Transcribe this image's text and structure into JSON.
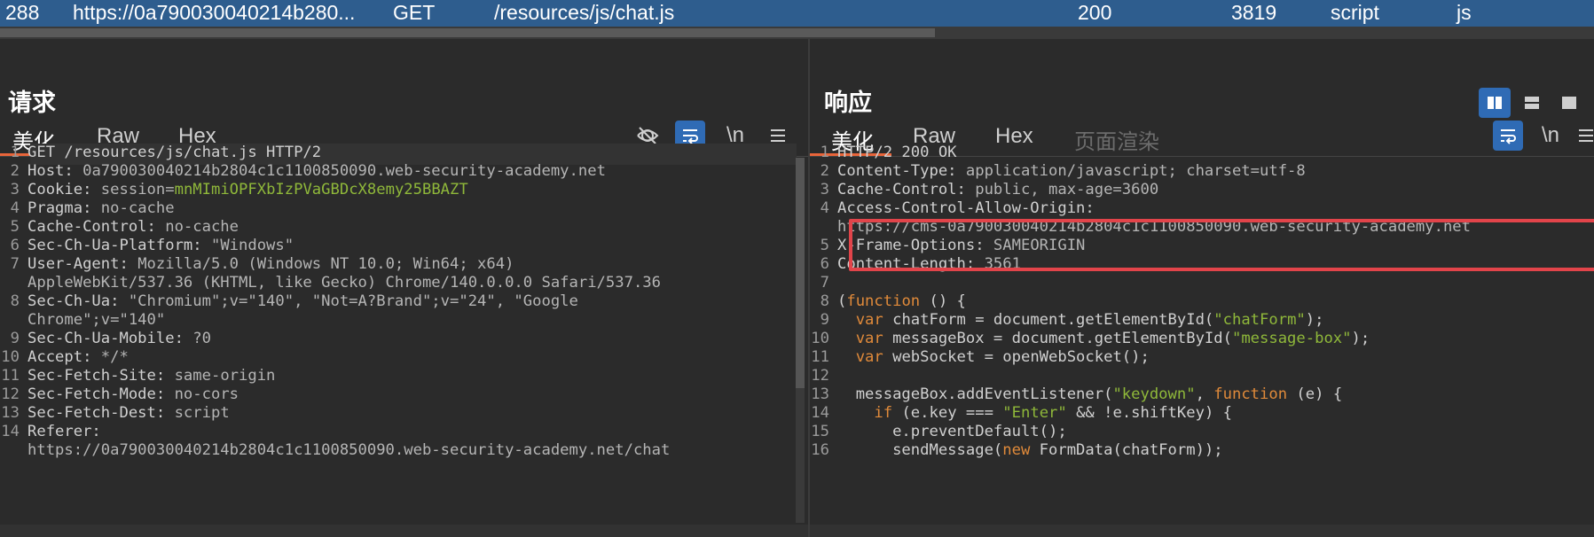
{
  "top_row": {
    "num": "288",
    "host": "https://0a790030040214b280...",
    "method": "GET",
    "path": "/resources/js/chat.js",
    "status": "200",
    "length": "3819",
    "type": "script",
    "ext": "js",
    "bg_color": "#2e5d8e"
  },
  "request": {
    "title": "请求",
    "tabs": [
      "美化",
      "Raw",
      "Hex"
    ],
    "active_tab": "美化",
    "toolbar_icons": [
      "eye-off-icon",
      "wrap-icon",
      "newline-icon",
      "menu-icon"
    ],
    "newline_label": "\\n",
    "lines": [
      {
        "n": "1",
        "k": "GET /resources/js/chat.js HTTP/2",
        "v": ""
      },
      {
        "n": "2",
        "k": "Host: ",
        "v": "0a790030040214b2804c1c1100850090.web-security-academy.net"
      },
      {
        "n": "3",
        "k": "Cookie: ",
        "v": "session=",
        "g": "mnMImiOPFXbIzPVaGBDcX8emy25BBAZT"
      },
      {
        "n": "4",
        "k": "Pragma: ",
        "v": "no-cache"
      },
      {
        "n": "5",
        "k": "Cache-Control: ",
        "v": "no-cache"
      },
      {
        "n": "6",
        "k": "Sec-Ch-Ua-Platform: ",
        "v": "\"Windows\""
      },
      {
        "n": "7",
        "k": "User-Agent: ",
        "v": "Mozilla/5.0 (Windows NT 10.0; Win64; x64)"
      },
      {
        "n": "",
        "k": "",
        "v": "AppleWebKit/537.36 (KHTML, like Gecko) Chrome/140.0.0.0 Safari/537.36"
      },
      {
        "n": "8",
        "k": "Sec-Ch-Ua: ",
        "v": "\"Chromium\";v=\"140\", \"Not=A?Brand\";v=\"24\", \"Google"
      },
      {
        "n": "",
        "k": "",
        "v": "Chrome\";v=\"140\""
      },
      {
        "n": "9",
        "k": "Sec-Ch-Ua-Mobile: ",
        "v": "?0"
      },
      {
        "n": "10",
        "k": "Accept: ",
        "v": "*/*"
      },
      {
        "n": "11",
        "k": "Sec-Fetch-Site: ",
        "v": "same-origin"
      },
      {
        "n": "12",
        "k": "Sec-Fetch-Mode: ",
        "v": "no-cors"
      },
      {
        "n": "13",
        "k": "Sec-Fetch-Dest: ",
        "v": "script"
      },
      {
        "n": "14",
        "k": "Referer: ",
        "v": ""
      },
      {
        "n": "",
        "k": "",
        "v": "https://0a790030040214b2804c1c1100850090.web-security-academy.net/chat"
      }
    ]
  },
  "response": {
    "title": "响应",
    "tabs": [
      "美化",
      "Raw",
      "Hex",
      "页面渲染"
    ],
    "active_tab": "美化",
    "disabled_tab": "页面渲染",
    "toolbar_icons": [
      "wrap-icon",
      "newline-icon",
      "menu-icon"
    ],
    "newline_label": "\\n",
    "view_buttons": [
      "split-columns-icon",
      "split-rows-icon",
      "single-pane-icon"
    ],
    "highlight_color": "#e2444a",
    "lines": [
      {
        "n": "1",
        "html": "<span class='k'>HTTP/2 200 OK</span>"
      },
      {
        "n": "2",
        "html": "<span class='k'>Content-Type: </span><span class='v'>application/javascript; charset=utf-8</span>"
      },
      {
        "n": "3",
        "html": "<span class='k'>Cache-Control: </span><span class='v'>public, max-age=3600</span>"
      },
      {
        "n": "4",
        "html": "<span class='k'>Access-Control-Allow-Origin: </span>"
      },
      {
        "n": "",
        "html": "<span class='v'>https://cms-0a790030040214b2804c1c1100850090.web-security-academy.net</span>"
      },
      {
        "n": "5",
        "html": "<span class='k'>X-Frame-Options: </span><span class='v'>SAMEORIGIN</span>"
      },
      {
        "n": "6",
        "html": "<span class='k'>Content-Length: </span><span class='v'>3561</span>"
      },
      {
        "n": "7",
        "html": ""
      },
      {
        "n": "8",
        "html": "<span class='k'>(</span><span class='kw'>function</span><span class='k'> () {</span>"
      },
      {
        "n": "9",
        "html": "<span class='k'>  </span><span class='kw'>var</span><span class='k'> chatForm = document.getElementById(</span><span class='s'>\"chatForm\"</span><span class='k'>);</span>"
      },
      {
        "n": "10",
        "html": "<span class='k'>  </span><span class='kw'>var</span><span class='k'> messageBox = document.getElementById(</span><span class='s'>\"message-box\"</span><span class='k'>);</span>"
      },
      {
        "n": "11",
        "html": "<span class='k'>  </span><span class='kw'>var</span><span class='k'> webSocket = openWebSocket();</span>"
      },
      {
        "n": "12",
        "html": ""
      },
      {
        "n": "13",
        "html": "<span class='k'>  messageBox.addEventListener(</span><span class='s'>\"keydown\"</span><span class='k'>, </span><span class='kw'>function</span><span class='k'> (e) {</span>"
      },
      {
        "n": "14",
        "html": "<span class='k'>    </span><span class='kw'>if</span><span class='k'> (e.key === </span><span class='s'>\"Enter\"</span><span class='k'> &amp;&amp; !e.shiftKey) {</span>"
      },
      {
        "n": "15",
        "html": "<span class='k'>      e.preventDefault();</span>"
      },
      {
        "n": "16",
        "html": "<span class='k'>      sendMessage(</span><span class='kw'>new</span><span class='k'> FormData(chatForm));</span>"
      }
    ]
  }
}
